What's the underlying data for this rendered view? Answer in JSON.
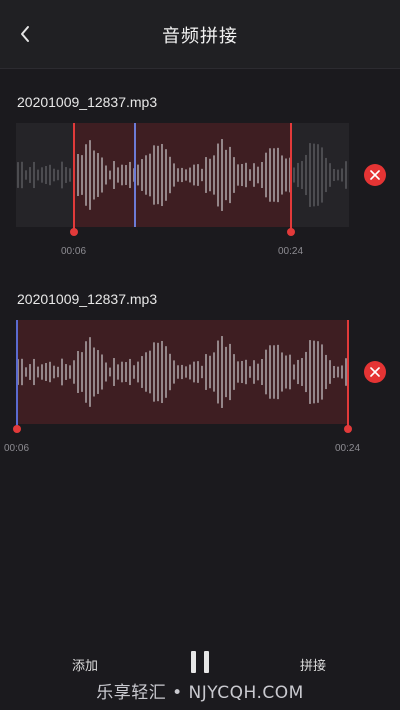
{
  "header": {
    "title": "音频拼接",
    "back_icon": "chevron-left-icon"
  },
  "clips": [
    {
      "filename": "20201009_12837.mp3",
      "start_time": "00:06",
      "end_time": "00:24",
      "remove_icon": "close-icon"
    },
    {
      "filename": "20201009_12837.mp3",
      "start_time": "00:06",
      "end_time": "00:24",
      "remove_icon": "close-icon"
    }
  ],
  "footer": {
    "add_label": "添加",
    "pause_icon": "pause-icon",
    "merge_label": "拼接"
  },
  "watermark": "乐享轻汇 • NJYCQH.COM",
  "colors": {
    "accent": "#e23a3a",
    "cursor": "#6c7bd6",
    "selection": "#3e1e22",
    "background": "#1b1a1e"
  }
}
